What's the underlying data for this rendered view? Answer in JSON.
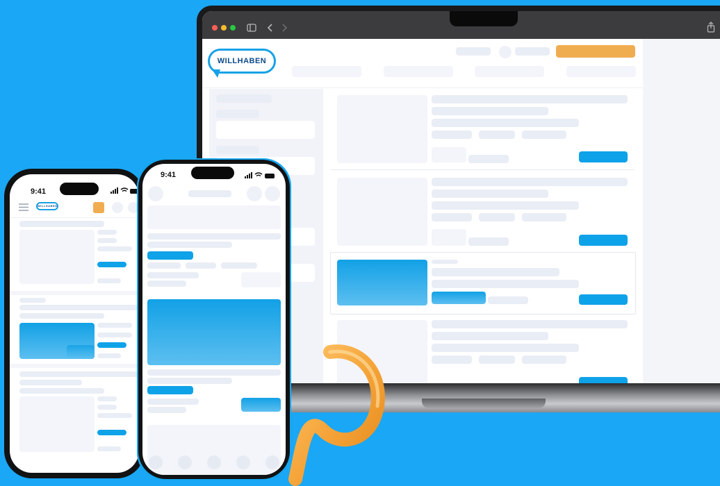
{
  "brand": {
    "logo_text": "WILLHABEN",
    "accent_color": "#0ea2e8",
    "cta_color": "#f0ad50",
    "background": "#1aa7f5"
  },
  "phone_left": {
    "status_time": "9:41"
  },
  "phone_right": {
    "status_time": "9:41"
  },
  "icons": [
    "share-icon",
    "sidebar-icon",
    "back-arrow-icon",
    "forward-arrow-icon",
    "menu-icon",
    "signal-icon",
    "wifi-icon",
    "battery-icon"
  ]
}
